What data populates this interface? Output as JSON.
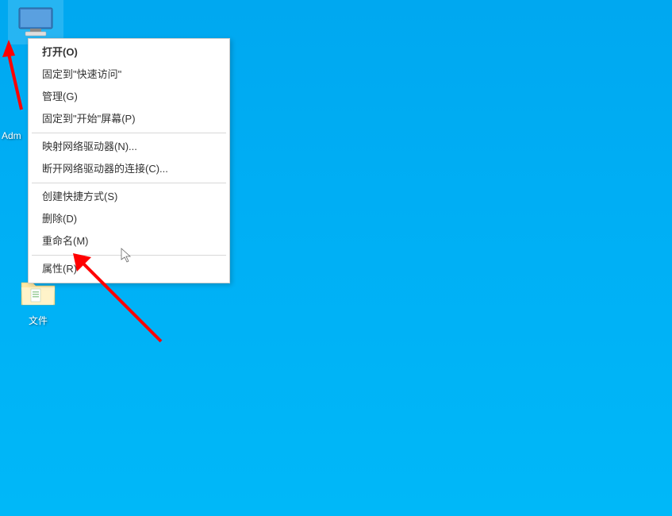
{
  "desktop": {
    "computer": {
      "label": ""
    },
    "admin": {
      "label": "Adm"
    },
    "unknown": {
      "label": ""
    },
    "folder": {
      "label": "文件"
    }
  },
  "context_menu": {
    "items": [
      {
        "label": "打开(O)",
        "bold": true
      },
      {
        "label": "固定到\"快速访问\""
      },
      {
        "label": "管理(G)"
      },
      {
        "label": "固定到\"开始\"屏幕(P)"
      },
      {
        "separator": true
      },
      {
        "label": "映射网络驱动器(N)..."
      },
      {
        "label": "断开网络驱动器的连接(C)..."
      },
      {
        "separator": true
      },
      {
        "label": "创建快捷方式(S)"
      },
      {
        "label": "删除(D)"
      },
      {
        "label": "重命名(M)"
      },
      {
        "separator": true
      },
      {
        "label": "属性(R)"
      }
    ]
  }
}
